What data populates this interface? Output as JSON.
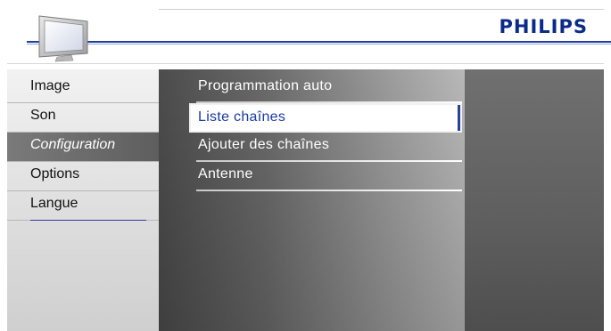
{
  "brand": {
    "name": "PHILIPS",
    "logo_color": "#0b2b8a"
  },
  "header": {
    "icon": "tv-icon"
  },
  "left_menu": {
    "items": [
      {
        "label": "Image",
        "selected": false
      },
      {
        "label": "Son",
        "selected": false
      },
      {
        "label": "Configuration",
        "selected": true
      },
      {
        "label": "Options",
        "selected": false
      },
      {
        "label": "Langue",
        "selected": false
      }
    ]
  },
  "middle_menu": {
    "items": [
      {
        "label": "Programmation auto",
        "highlighted": false
      },
      {
        "label": "Liste chaînes",
        "highlighted": true
      },
      {
        "label": "Ajouter des chaînes",
        "highlighted": false
      },
      {
        "label": "Antenne",
        "highlighted": false
      }
    ]
  },
  "colors": {
    "accent": "#1a3aa0",
    "highlight_bg": "#ffffff",
    "selected_bg": "#6a6a6a"
  }
}
